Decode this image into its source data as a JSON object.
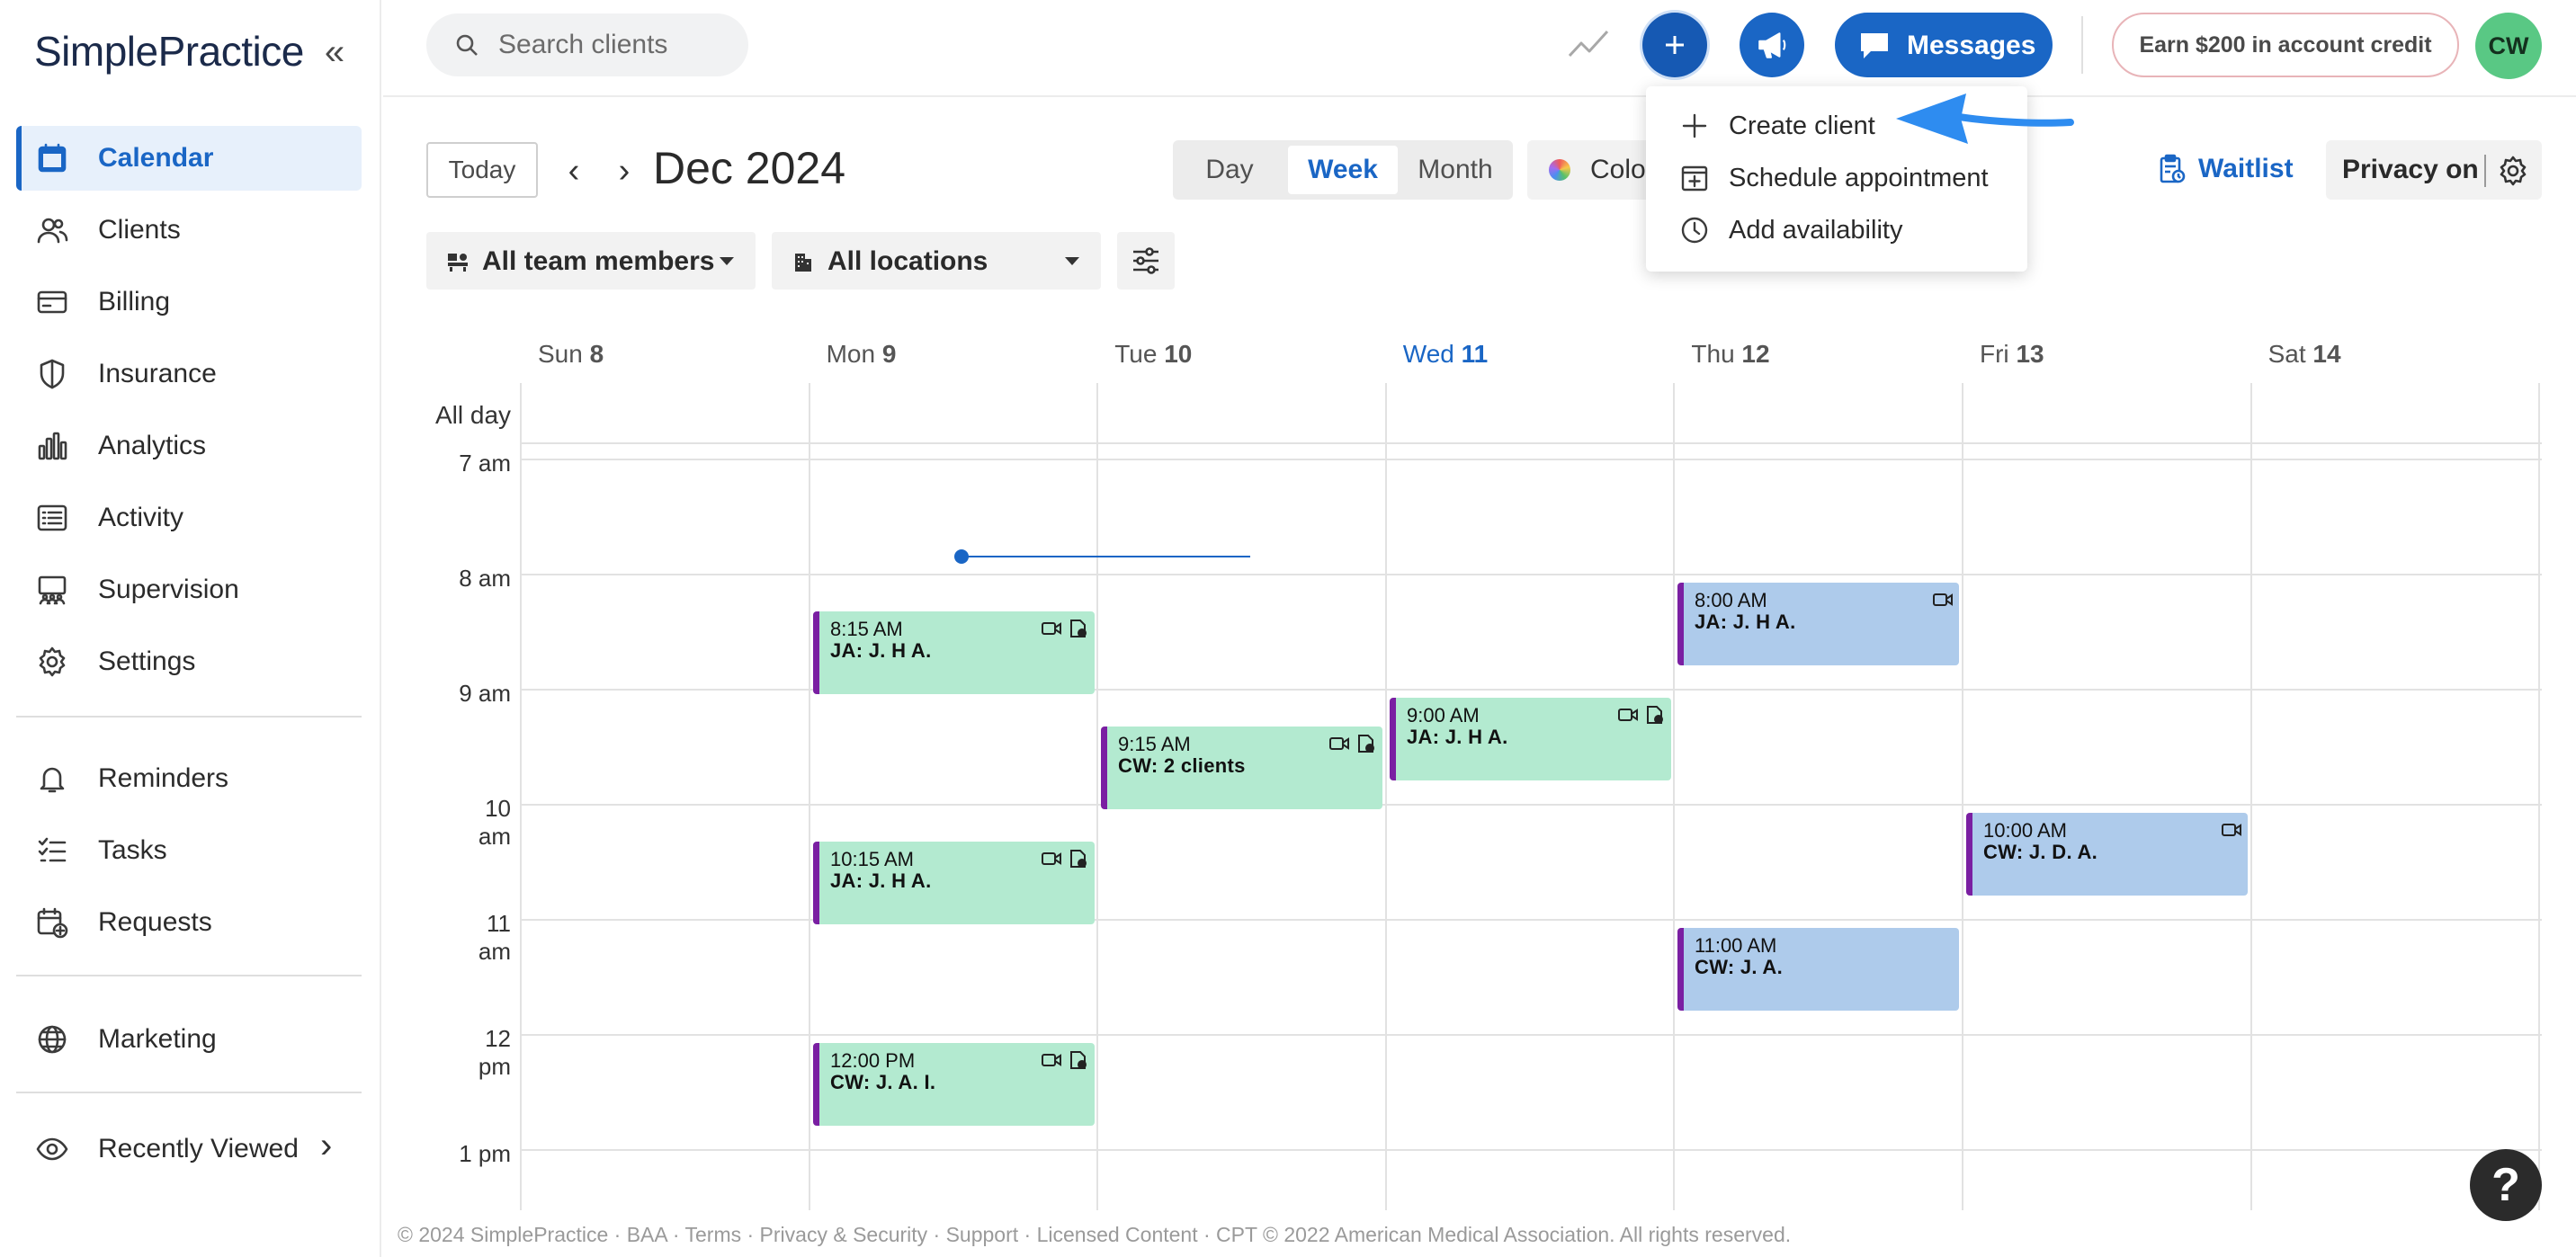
{
  "brand": {
    "logo_text": "SimplePractice"
  },
  "sidebar": {
    "items": [
      {
        "label": "Calendar",
        "icon": "calendar-icon",
        "active": true
      },
      {
        "label": "Clients",
        "icon": "users-icon"
      },
      {
        "label": "Billing",
        "icon": "credit-card-icon"
      },
      {
        "label": "Insurance",
        "icon": "shield-icon"
      },
      {
        "label": "Analytics",
        "icon": "bar-chart-icon"
      },
      {
        "label": "Activity",
        "icon": "list-icon"
      },
      {
        "label": "Supervision",
        "icon": "supervision-icon"
      },
      {
        "label": "Settings",
        "icon": "gear-icon"
      }
    ],
    "secondary": [
      {
        "label": "Reminders",
        "icon": "bell-icon"
      },
      {
        "label": "Tasks",
        "icon": "checklist-icon"
      },
      {
        "label": "Requests",
        "icon": "calendar-plus-icon"
      }
    ],
    "tertiary": [
      {
        "label": "Marketing",
        "icon": "globe-icon"
      }
    ],
    "recently_viewed": {
      "label": "Recently Viewed",
      "icon": "eye-icon"
    }
  },
  "topbar": {
    "search_placeholder": "Search clients",
    "messages_label": "Messages",
    "earn_label": "Earn $200 in account credit",
    "avatar_initials": "CW"
  },
  "toolbar": {
    "today_label": "Today",
    "month_title": "Dec 2024",
    "views": [
      "Day",
      "Week",
      "Month"
    ],
    "active_view": "Week",
    "colors_label": "Colors",
    "waitlist_label": "Waitlist",
    "privacy_label": "Privacy on",
    "team_filter": "All team members",
    "location_filter": "All locations"
  },
  "dropdown": {
    "items": [
      {
        "label": "Create client",
        "icon": "plus-icon"
      },
      {
        "label": "Schedule appointment",
        "icon": "calendar-add-icon"
      },
      {
        "label": "Add availability",
        "icon": "clock-icon"
      }
    ]
  },
  "calendar": {
    "all_day_label": "All day",
    "days": [
      {
        "name": "Sun",
        "num": "8"
      },
      {
        "name": "Mon",
        "num": "9"
      },
      {
        "name": "Tue",
        "num": "10"
      },
      {
        "name": "Wed",
        "num": "11",
        "today": true
      },
      {
        "name": "Thu",
        "num": "12"
      },
      {
        "name": "Fri",
        "num": "13"
      },
      {
        "name": "Sat",
        "num": "14"
      }
    ],
    "hours": [
      "7 am",
      "8 am",
      "9 am",
      "10 am",
      "11 am",
      "12 pm",
      "1 pm"
    ],
    "events": [
      {
        "day": 1,
        "time": "8:15 AM",
        "who": "JA: J. H A.",
        "color": "green",
        "icons": [
          "video-icon",
          "file-icon"
        ]
      },
      {
        "day": 1,
        "time": "10:15 AM",
        "who": "JA: J. H A.",
        "color": "green",
        "icons": [
          "video-icon",
          "file-icon"
        ]
      },
      {
        "day": 1,
        "time": "12:00 PM",
        "who": "CW: J. A. I.",
        "color": "green",
        "icons": [
          "video-icon",
          "file-icon"
        ]
      },
      {
        "day": 2,
        "time": "9:15 AM",
        "who": "CW: 2 clients",
        "color": "green",
        "icons": [
          "video-icon",
          "file-icon"
        ]
      },
      {
        "day": 3,
        "time": "9:00 AM",
        "who": "JA: J. H A.",
        "color": "green",
        "icons": [
          "video-icon",
          "file-icon"
        ]
      },
      {
        "day": 4,
        "time": "8:00 AM",
        "who": "JA: J. H A.",
        "color": "blue",
        "icons": [
          "video-icon"
        ]
      },
      {
        "day": 4,
        "time": "11:00 AM",
        "who": "CW: J. A.",
        "color": "blue",
        "icons": []
      },
      {
        "day": 5,
        "time": "10:00 AM",
        "who": "CW: J. D. A.",
        "color": "blue",
        "icons": [
          "video-icon"
        ]
      }
    ]
  },
  "footer": {
    "text": "© 2024 SimplePractice · BAA · Terms · Privacy & Security · Support · Licensed Content · CPT © 2022 American Medical Association. All rights reserved."
  },
  "help_label": "?",
  "colors": {
    "accent": "#1a66c5",
    "event_green": "#b3ead0",
    "event_blue": "#aecbeb",
    "event_border": "#7a1fa2"
  }
}
